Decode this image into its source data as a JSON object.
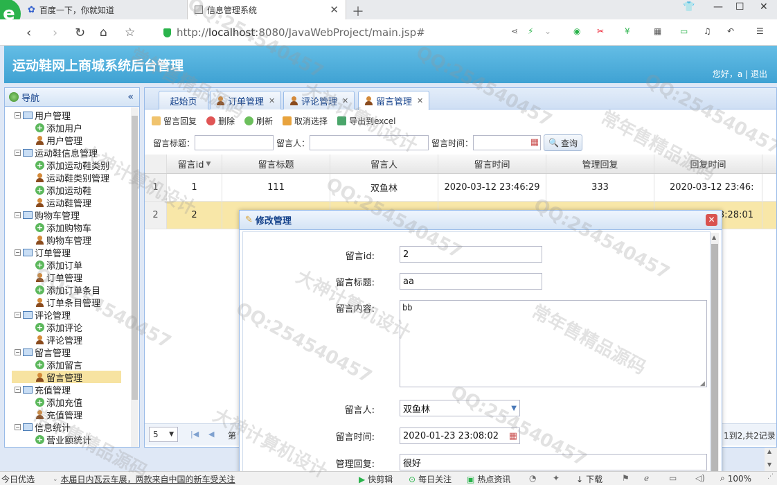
{
  "browser": {
    "tabs": [
      {
        "label": "百度一下，你就知道"
      },
      {
        "label": "信息管理系统"
      }
    ],
    "url_host": "localhost",
    "url_prefix": "http://",
    "url_rest": ":8080/JavaWebProject/main.jsp#"
  },
  "app": {
    "title": "运动鞋网上商城系统后台管理",
    "greeting": "您好，a",
    "sep": "|",
    "logout": "退出"
  },
  "nav": {
    "title": "导航",
    "groups": [
      {
        "label": "用户管理",
        "items": [
          {
            "label": "添加用户",
            "icon": "add"
          },
          {
            "label": "用户管理",
            "icon": "user"
          }
        ]
      },
      {
        "label": "运动鞋信息管理",
        "items": [
          {
            "label": "添加运动鞋类别",
            "icon": "add"
          },
          {
            "label": "运动鞋类别管理",
            "icon": "user"
          },
          {
            "label": "添加运动鞋",
            "icon": "add"
          },
          {
            "label": "运动鞋管理",
            "icon": "user"
          }
        ]
      },
      {
        "label": "购物车管理",
        "items": [
          {
            "label": "添加购物车",
            "icon": "add"
          },
          {
            "label": "购物车管理",
            "icon": "user"
          }
        ]
      },
      {
        "label": "订单管理",
        "items": [
          {
            "label": "添加订单",
            "icon": "add"
          },
          {
            "label": "订单管理",
            "icon": "user"
          },
          {
            "label": "添加订单条目",
            "icon": "add"
          },
          {
            "label": "订单条目管理",
            "icon": "user"
          }
        ]
      },
      {
        "label": "评论管理",
        "items": [
          {
            "label": "添加评论",
            "icon": "add"
          },
          {
            "label": "评论管理",
            "icon": "user"
          }
        ]
      },
      {
        "label": "留言管理",
        "items": [
          {
            "label": "添加留言",
            "icon": "add"
          },
          {
            "label": "留言管理",
            "icon": "user",
            "selected": true
          }
        ]
      },
      {
        "label": "充值管理",
        "items": [
          {
            "label": "添加充值",
            "icon": "add"
          },
          {
            "label": "充值管理",
            "icon": "user"
          }
        ]
      },
      {
        "label": "信息统计",
        "items": [
          {
            "label": "营业额统计",
            "icon": "add"
          }
        ]
      }
    ]
  },
  "main": {
    "tabs": [
      {
        "label": "起始页",
        "closable": false
      },
      {
        "label": "订单管理",
        "closable": true
      },
      {
        "label": "评论管理",
        "closable": true
      },
      {
        "label": "留言管理",
        "closable": true,
        "active": true
      }
    ],
    "toolbar": {
      "reply": "留言回复",
      "delete": "删除",
      "refresh": "刷新",
      "cancel_select": "取消选择",
      "export": "导出到excel"
    },
    "search": {
      "title_label": "留言标题：",
      "author_label": "留言人：",
      "time_label": "留言时间：",
      "query": "查询"
    },
    "grid": {
      "columns": [
        "留言id",
        "留言标题",
        "留言人",
        "留言时间",
        "管理回复",
        "回复时间"
      ],
      "rows": [
        {
          "rn": "1",
          "cells": [
            "1",
            "111",
            "双鱼林",
            "2020-03-12 23:46:29",
            "333",
            "2020-03-12 23:46:"
          ]
        },
        {
          "rn": "2",
          "cells": [
            "2",
            "",
            "",
            "",
            "",
            "3:28:01"
          ]
        }
      ]
    },
    "pager": {
      "page_size": "5",
      "page_prefix": "第",
      "summary": "1到2,共2记录"
    }
  },
  "dialog": {
    "title": "修改管理",
    "fields": {
      "id_label": "留言id:",
      "id_value": "2",
      "title_label": "留言标题:",
      "title_value": "aa",
      "content_label": "留言内容:",
      "content_value": "bb",
      "author_label": "留言人:",
      "author_value": "双鱼林",
      "time_label": "留言时间:",
      "time_value": "2020-01-23 23:08:02",
      "reply_label": "管理回复:",
      "reply_value": "很好"
    }
  },
  "statusbar": {
    "left": "今日优选",
    "news": "本届日内瓦云车展，两款来自中国的新车受关注",
    "items": [
      "快剪辑",
      "每日关注",
      "热点资讯"
    ],
    "download": "下载",
    "zoom": "100%"
  },
  "watermark": {
    "qq": "QQ:254540457",
    "a": "大神计算机设计",
    "b": "常年售精品源码"
  }
}
